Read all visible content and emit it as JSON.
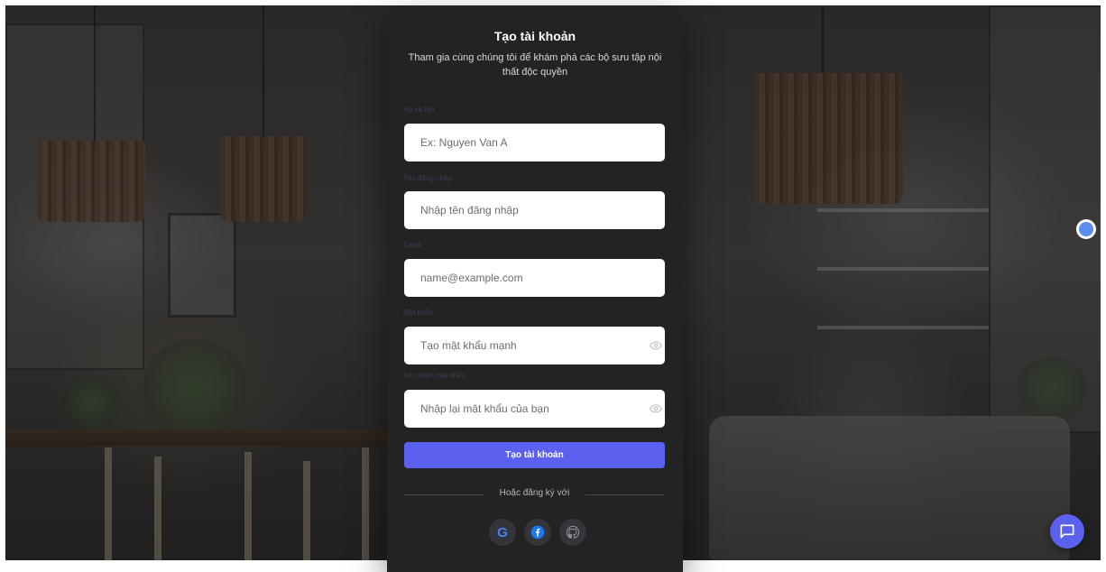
{
  "card": {
    "title": "Tạo tài khoản",
    "subtitle": "Tham gia cùng chúng tôi để khám phá các bộ sưu tập nội thất độc quyền"
  },
  "fields": {
    "fullname": {
      "label": "Họ và tên",
      "placeholder": "Ex: Nguyen Van A",
      "value": ""
    },
    "username": {
      "label": "Tên đăng nhập",
      "placeholder": "Nhập tên đăng nhập",
      "value": ""
    },
    "email": {
      "label": "Email",
      "placeholder": "name@example.com",
      "value": ""
    },
    "password": {
      "label": "Mật khẩu",
      "placeholder": "Tạo mật khẩu mạnh",
      "value": ""
    },
    "confirm": {
      "label": "Xác nhận mật khẩu",
      "placeholder": "Nhập lại mật khẩu của bạn",
      "value": ""
    }
  },
  "submit_label": "Tạo tài khoản",
  "divider_text": "Hoặc đăng ký với",
  "social": {
    "google_letter": "G",
    "icons": [
      "google-icon",
      "facebook-icon",
      "github-icon"
    ]
  },
  "colors": {
    "accent": "#5b61ee",
    "card_bg": "#232324",
    "label": "#3a3f57",
    "google_blue": "#4285f4",
    "google_red": "#ea4335",
    "facebook_blue": "#1877f2"
  },
  "floating": {
    "side_badge_icon": "accessibility-icon",
    "chat_icon": "chat-bubble-icon"
  }
}
